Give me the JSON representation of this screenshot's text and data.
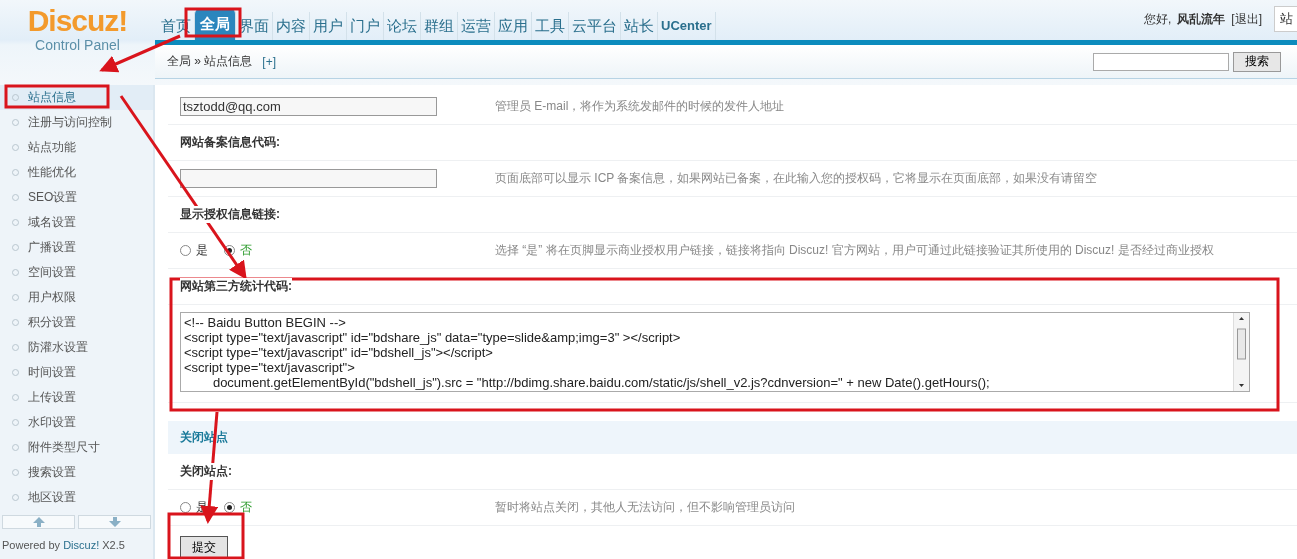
{
  "logo": {
    "name": "Discuz!",
    "subtitle": "Control Panel"
  },
  "nav": [
    {
      "label": "首页",
      "selected": false
    },
    {
      "label": "全局",
      "selected": true
    },
    {
      "label": "界面",
      "selected": false
    },
    {
      "label": "内容",
      "selected": false
    },
    {
      "label": "用户",
      "selected": false
    },
    {
      "label": "门户",
      "selected": false
    },
    {
      "label": "论坛",
      "selected": false
    },
    {
      "label": "群组",
      "selected": false
    },
    {
      "label": "运营",
      "selected": false
    },
    {
      "label": "应用",
      "selected": false
    },
    {
      "label": "工具",
      "selected": false
    },
    {
      "label": "云平台",
      "selected": false
    },
    {
      "label": "站长",
      "selected": false
    },
    {
      "label": "UCenter",
      "selected": false
    }
  ],
  "user": {
    "greeting": "您好,",
    "name": "风乱流年",
    "logout": "[退出]",
    "cut_button": "站"
  },
  "breadcrumb": {
    "path": "全局 » 站点信息",
    "add": "[+]"
  },
  "search": {
    "button": "搜索"
  },
  "sidebar": {
    "items": [
      {
        "label": "站点信息",
        "selected": true
      },
      {
        "label": "注册与访问控制",
        "selected": false
      },
      {
        "label": "站点功能",
        "selected": false
      },
      {
        "label": "性能优化",
        "selected": false
      },
      {
        "label": "SEO设置",
        "selected": false
      },
      {
        "label": "域名设置",
        "selected": false
      },
      {
        "label": "广播设置",
        "selected": false
      },
      {
        "label": "空间设置",
        "selected": false
      },
      {
        "label": "用户权限",
        "selected": false
      },
      {
        "label": "积分设置",
        "selected": false
      },
      {
        "label": "防灌水设置",
        "selected": false
      },
      {
        "label": "时间设置",
        "selected": false
      },
      {
        "label": "上传设置",
        "selected": false
      },
      {
        "label": "水印设置",
        "selected": false
      },
      {
        "label": "附件类型尺寸",
        "selected": false
      },
      {
        "label": "搜索设置",
        "selected": false
      },
      {
        "label": "地区设置",
        "selected": false
      }
    ],
    "footer": "Powered by",
    "footer_link": "Discuz!",
    "footer_version": "X2.5"
  },
  "settings": [
    {
      "kind": "input",
      "value": "tsztodd@qq.com",
      "tip": "管理员 E-mail，将作为系统发邮件的时候的发件人地址"
    },
    {
      "kind": "label",
      "text": "网站备案信息代码:"
    },
    {
      "kind": "input",
      "tip": "页面底部可以显示 ICP 备案信息，如果网站已备案，在此输入您的授权码，它将显示在页面底部，如果没有请留空"
    },
    {
      "kind": "label",
      "text": "显示授权信息链接:"
    },
    {
      "kind": "radio",
      "options": [
        {
          "label": "是",
          "selected": false
        },
        {
          "label": "否",
          "selected": true
        }
      ],
      "tip": "选择 “是” 将在页脚显示商业授权用户链接，链接将指向 Discuz! 官方网站，用户可通过此链接验证其所使用的 Discuz! 是否经过商业授权"
    },
    {
      "kind": "label",
      "text": "网站第三方统计代码:"
    },
    {
      "kind": "code",
      "lines": [
        "<!-- Baidu Button BEGIN -->",
        "<script type=\"text/javascript\" id=\"bdshare_js\" data=\"type=slide&amp;img=3\" ></script>",
        "<script type=\"text/javascript\" id=\"bdshell_js\"></script>",
        "<script type=\"text/javascript\">",
        "\tdocument.getElementById(\"bdshell_js\").src = \"http://bdimg.share.baidu.com/static/js/shell_v2.js?cdnversion=\" + new Date().getHours();"
      ]
    },
    {
      "kind": "section",
      "text": "关闭站点"
    },
    {
      "kind": "label",
      "text": "关闭站点:"
    },
    {
      "kind": "radio",
      "options": [
        {
          "label": "是",
          "selected": false
        },
        {
          "label": "否",
          "selected": true
        }
      ],
      "tip": "暂时将站点关闭，其他人无法访问，但不影响管理员访问"
    }
  ],
  "submit": "提交"
}
